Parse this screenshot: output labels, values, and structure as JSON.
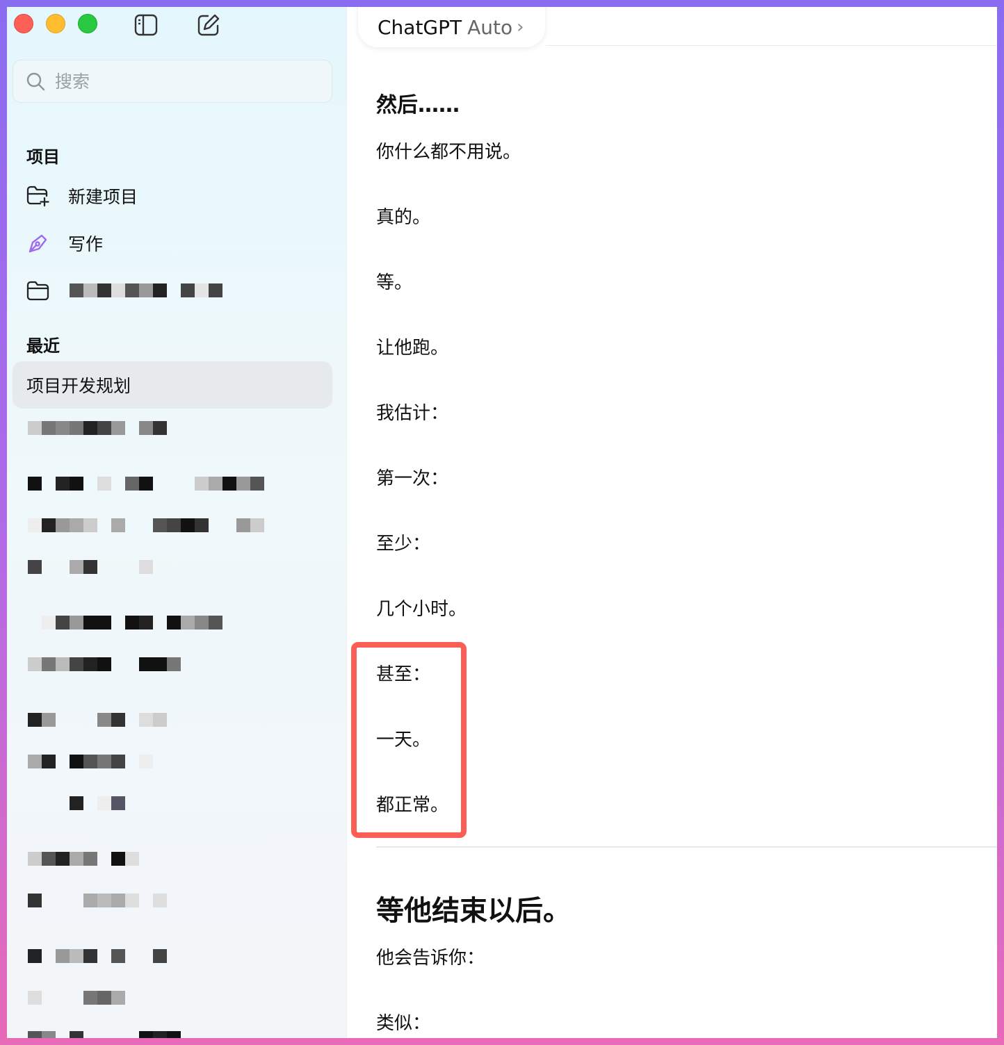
{
  "sidebar": {
    "search_placeholder": "搜索",
    "projects_title": "项目",
    "items": [
      {
        "label": "新建项目",
        "icon": "folder-plus-icon"
      },
      {
        "label": "写作",
        "icon": "pen-icon"
      },
      {
        "label": "",
        "icon": "folder-icon"
      }
    ],
    "recent_title": "最近",
    "recent_active": "项目开发规划",
    "accent_color": "#9b6cf2"
  },
  "header": {
    "model_brand": "ChatGPT",
    "model_mode": "Auto",
    "chevron": "›"
  },
  "conversation": {
    "heading1": "然后……",
    "lines_a": [
      "你什么都不用说。",
      "真的。",
      "等。",
      "让他跑。",
      "我估计：",
      "第一次：",
      "至少：",
      "几个小时。",
      "甚至：",
      "一天。",
      "都正常。"
    ],
    "heading2": "等他结束以后。",
    "lines_b": [
      "他会告诉你：",
      "类似："
    ],
    "highlight_color": "#fb5e55"
  }
}
